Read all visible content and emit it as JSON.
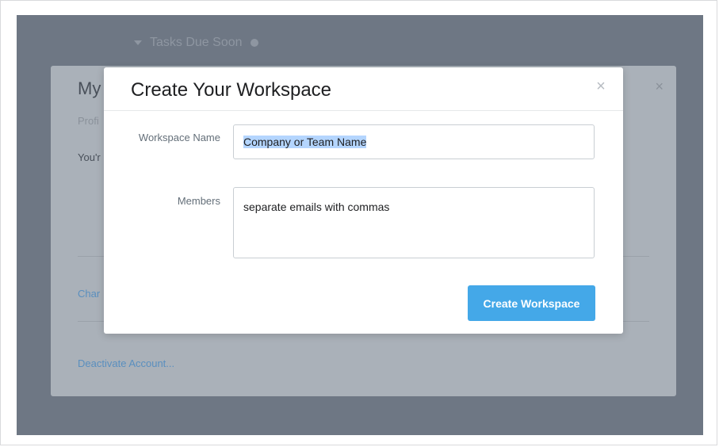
{
  "background": {
    "section_title": "Tasks Due Soon",
    "panel_title": "My",
    "panel_tab": "Profi",
    "panel_text": "You'r",
    "change_link": "Char",
    "deactivate_link": "Deactivate Account..."
  },
  "modal": {
    "title": "Create Your Workspace",
    "close_symbol": "×",
    "workspace_label": "Workspace Name",
    "workspace_value": "Company or Team Name",
    "members_label": "Members",
    "members_placeholder": "separate emails with commas",
    "submit_label": "Create Workspace"
  },
  "colors": {
    "overlay": "#6e7784",
    "primary_button": "#44a8e8",
    "selection": "#b4d5fe"
  }
}
